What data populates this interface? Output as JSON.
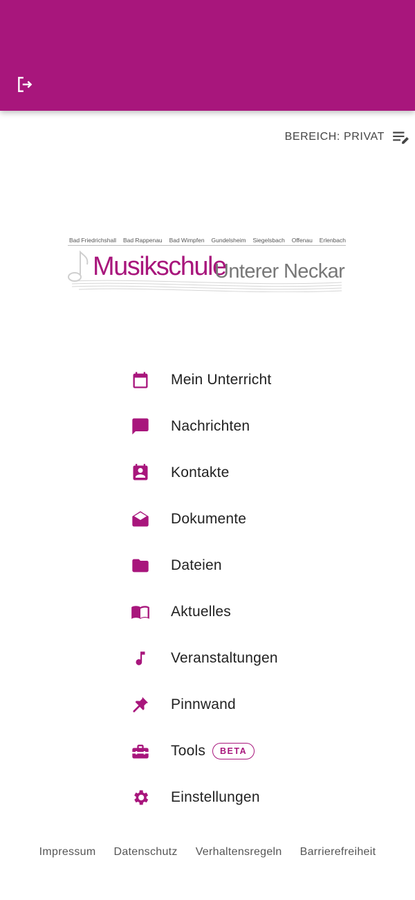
{
  "colors": {
    "brand": "#a8167c",
    "text": "#222222",
    "muted": "#555555"
  },
  "header": {
    "logout_icon": "logout-icon"
  },
  "bereich": {
    "label": "BEREICH: PRIVAT",
    "icon": "edit-list-icon"
  },
  "logo": {
    "towns": [
      "Bad Friedrichshall",
      "Bad Rappenau",
      "Bad Wimpfen",
      "Gundelsheim",
      "Siegelsbach",
      "Offenau",
      "Erlenbach"
    ],
    "title": "Musikschule",
    "subtitle": "Unterer Neckar"
  },
  "menu": [
    {
      "label": "Mein Unterricht",
      "icon": "calendar-icon"
    },
    {
      "label": "Nachrichten",
      "icon": "message-icon"
    },
    {
      "label": "Kontakte",
      "icon": "contact-card-icon"
    },
    {
      "label": "Dokumente",
      "icon": "open-envelope-icon"
    },
    {
      "label": "Dateien",
      "icon": "folder-icon"
    },
    {
      "label": "Aktuelles",
      "icon": "book-icon"
    },
    {
      "label": "Veranstaltungen",
      "icon": "music-note-icon"
    },
    {
      "label": "Pinnwand",
      "icon": "pin-icon"
    },
    {
      "label": "Tools",
      "icon": "toolbox-icon",
      "badge": "BETA"
    },
    {
      "label": "Einstellungen",
      "icon": "gear-icon"
    }
  ],
  "footer": {
    "links": [
      "Impressum",
      "Datenschutz",
      "Verhaltensregeln",
      "Barrierefreiheit"
    ]
  }
}
